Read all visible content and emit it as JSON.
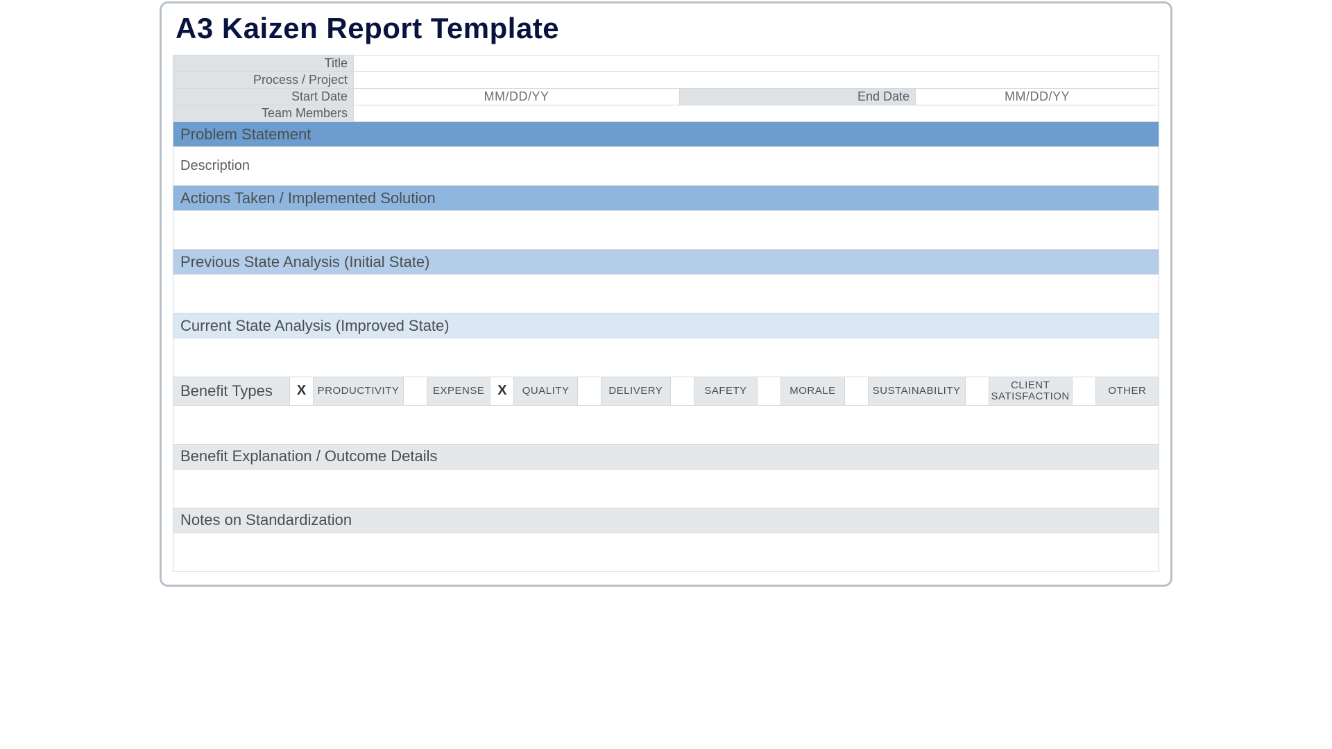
{
  "title": "A3 Kaizen Report Template",
  "header": {
    "labels": {
      "title": "Title",
      "process_project": "Process / Project",
      "start_date": "Start Date",
      "end_date": "End Date",
      "team_members": "Team Members"
    },
    "values": {
      "title": "",
      "process_project": "",
      "start_date_placeholder": "MM/DD/YY",
      "end_date_placeholder": "MM/DD/YY",
      "team_members": ""
    }
  },
  "sections": {
    "problem_statement": "Problem Statement",
    "problem_description": "Description",
    "actions_taken": "Actions Taken / Implemented Solution",
    "previous_state": "Previous State Analysis (Initial State)",
    "current_state": "Current State Analysis (Improved State)",
    "benefit_explanation": "Benefit Explanation / Outcome Details",
    "notes_standardization": "Notes on Standardization"
  },
  "benefit_types": {
    "title": "Benefit Types",
    "items": [
      {
        "label": "PRODUCTIVITY",
        "checked": "X"
      },
      {
        "label": "EXPENSE",
        "checked": ""
      },
      {
        "label": "QUALITY",
        "checked": "X"
      },
      {
        "label": "DELIVERY",
        "checked": ""
      },
      {
        "label": "SAFETY",
        "checked": ""
      },
      {
        "label": "MORALE",
        "checked": ""
      },
      {
        "label": "SUSTAINABILITY",
        "checked": ""
      },
      {
        "label": "CLIENT SATISFACTION",
        "checked": ""
      },
      {
        "label": "OTHER",
        "checked": ""
      }
    ]
  }
}
